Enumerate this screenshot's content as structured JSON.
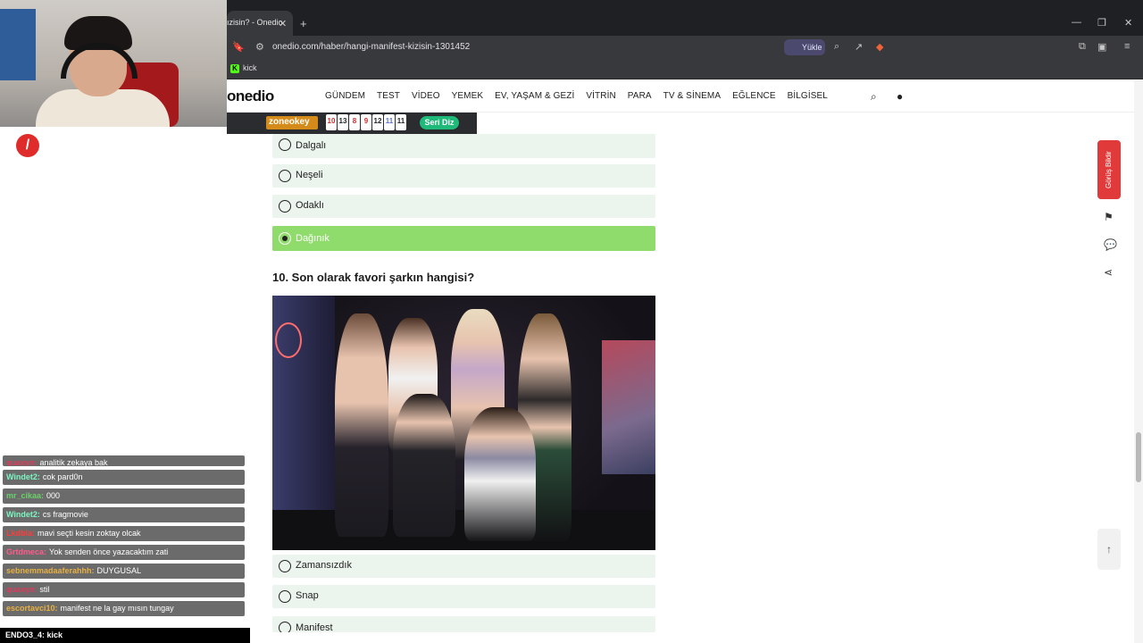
{
  "browser": {
    "tab_title": "ızisin? - Onedio",
    "tab_close": "✕",
    "tab_add": "+",
    "url": "onedio.com/haber/hangi-manifest-kizisin-1301452",
    "upload_chip": "Yükle",
    "bookmark_kick": "kick",
    "window": {
      "minimize": "—",
      "restore": "❐",
      "close": "✕"
    }
  },
  "site": {
    "logo": "onedio",
    "nav": [
      "GÜNDEM",
      "TEST",
      "VİDEO",
      "YEMEK",
      "EV, YAŞAM & GEZİ",
      "VİTRİN",
      "PARA",
      "TV & SİNEMA",
      "EĞLENCE",
      "BİLGİSEL"
    ],
    "search_icon": "search-icon",
    "user_icon": "user-icon"
  },
  "ad": {
    "zone_label": "zoneokey",
    "tiles": [
      "10",
      "13",
      "8",
      "9",
      "12",
      "11",
      "11"
    ],
    "tile_colors": [
      "#d12b2b",
      "#222222",
      "#d12b2b",
      "#d12b2b",
      "#222222",
      "#5b73c9",
      "#222222"
    ],
    "seri_diz": "Seri Diz"
  },
  "quiz": {
    "prev_options": [
      {
        "label": "Dalgalı",
        "selected": false
      },
      {
        "label": "Neşeli",
        "selected": false
      },
      {
        "label": "Odaklı",
        "selected": false
      },
      {
        "label": "Dağınık",
        "selected": true
      }
    ],
    "question": "10. Son olarak favori şarkın hangisi?",
    "options": [
      {
        "label": "Zamansızdık",
        "selected": false
      },
      {
        "label": "Snap",
        "selected": false
      },
      {
        "label": "Manifest",
        "selected": false
      }
    ]
  },
  "side_tools": {
    "report_label": "Görüş Bildir",
    "bookmark_icon": "bookmark-icon",
    "comments_icon": "comments-icon",
    "share_icon": "share-icon",
    "top_icon": "arrow-up-icon"
  },
  "chat": {
    "messages": [
      {
        "user": "quaxyn:",
        "text": "analitik zekaya bak",
        "color": "#e03a5a"
      },
      {
        "user": "Windet2:",
        "text": "cok pard0n",
        "color": "#7cf5c2"
      },
      {
        "user": "mr_cikaa:",
        "text": "000",
        "color": "#6bd16b"
      },
      {
        "user": "Windet2:",
        "text": "cs fragmovie",
        "color": "#7cf5c2"
      },
      {
        "user": "Lkdbla:",
        "text": "mavi seçti kesin zoktay olcak",
        "color": "#ff3b3b"
      },
      {
        "user": "Grtdmeca:",
        "text": "Yok senden önce yazacaktım zati",
        "color": "#ff5b8b"
      },
      {
        "user": "sebnemmadaaferahhh:",
        "text": "DUYGUSAL",
        "color": "#e8b042"
      },
      {
        "user": "quaxyn:",
        "text": "stil",
        "color": "#e03a5a"
      },
      {
        "user": "escortavci10:",
        "text": "manifest ne la gay mısın tungay",
        "color": "#e8b042"
      }
    ],
    "ticker": "ENDO3_4: kick"
  }
}
